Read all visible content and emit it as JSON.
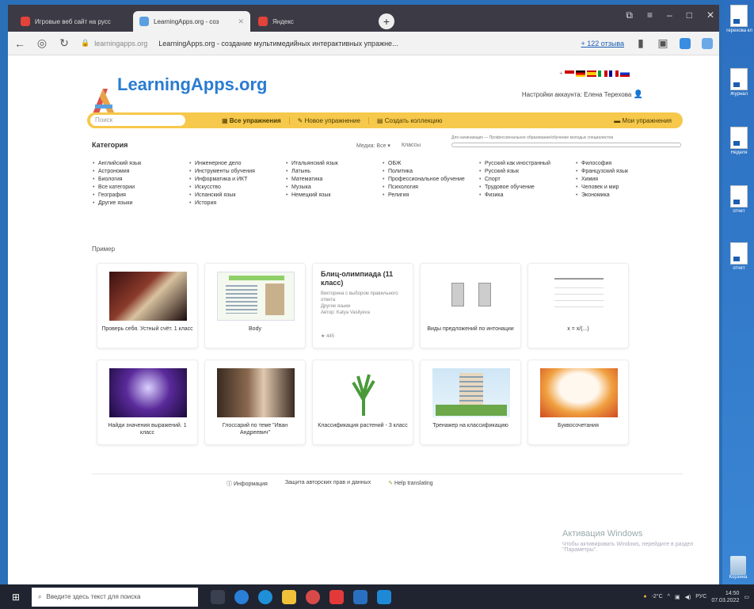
{
  "browser": {
    "tabs": [
      {
        "label": "Игровые веб сайт на русс",
        "active": false
      },
      {
        "label": "LearningApps.org - соз",
        "active": true
      },
      {
        "label": "Яндекс",
        "active": false
      }
    ],
    "new_tab": "+",
    "url_host": "learningapps.org",
    "url_title": "LearningApps.org - создание мультимедийных интерактивных упражне...",
    "reviews": "+ 122 отзыва"
  },
  "page": {
    "logo": "LearningApps.org",
    "account": "Настройки аккаунта: Елена Терехова",
    "search_placeholder": "Поиск",
    "menu": {
      "all": "Все упражнения",
      "new": "Новое упражнение",
      "collection": "Создать коллекцию",
      "mine": "Мои упражнения"
    },
    "categories_label": "Категория",
    "media_filter": "Медиа: Все ▾",
    "class_filter": "Классы",
    "level_text": "Для начинающих — Профессиональное образование/обучение молодых специалистов",
    "categories": [
      [
        "Английский язык",
        "Астрономия",
        "Биология",
        "Все категории",
        "География",
        "Другие языки"
      ],
      [
        "Инженерное дело",
        "Инструменты обучения",
        "Информатика и ИКТ",
        "Искусство",
        "Испанский язык",
        "История"
      ],
      [
        "Итальянский язык",
        "Латынь",
        "Математика",
        "Музыка",
        "Немецкий язык"
      ],
      [
        "ОБЖ",
        "Политика",
        "Профессиональное обучение",
        "Психология",
        "Религия"
      ],
      [
        "Русский как иностранный",
        "Русский язык",
        "Спорт",
        "Трудовое обучение",
        "Физика"
      ],
      [
        "Философия",
        "Французский язык",
        "Химия",
        "Человек и мир",
        "Экономика"
      ]
    ],
    "example_label": "Пример",
    "cards_row1": [
      {
        "title": "Проверь себя. Устный счёт. 1 класс"
      },
      {
        "title": "Body"
      },
      {
        "title": "Блиц-олимпиада (11 класс)",
        "desc": "Викторина с выбором правильного ответа",
        "cat": "Другие языки",
        "author": "Автор: Katya Vasilyeva",
        "stats": "★ 445"
      },
      {
        "title": "Виды предложений по интонации"
      },
      {
        "title": "x = x/(...)"
      }
    ],
    "cards_row2": [
      {
        "title": "Найди значения выражений. 1 класс"
      },
      {
        "title": "Глоссарий по теме \"Иван Андреевич\""
      },
      {
        "title": "Классификация растений - 3 класс"
      },
      {
        "title": "Тренажер на классификацию"
      },
      {
        "title": "Буквосочетания"
      }
    ],
    "footer": {
      "info": "Информация",
      "privacy": "Защита авторских прав и данных",
      "help": "Help translating"
    },
    "watermark": "Активация Windows",
    "watermark_sub": "Чтобы активировать Windows, перейдите в раздел \"Параметры\"."
  },
  "taskbar": {
    "search": "Введите здесь текст для поиска",
    "temp": "-2°C",
    "lang": "РУС",
    "time": "14:50",
    "date": "07.03.2022"
  },
  "desktop": {
    "icons": [
      "Терехова кл",
      "Журнал",
      "Неделя",
      "отчёт",
      "отчёт"
    ],
    "recycle": "Корзина"
  }
}
